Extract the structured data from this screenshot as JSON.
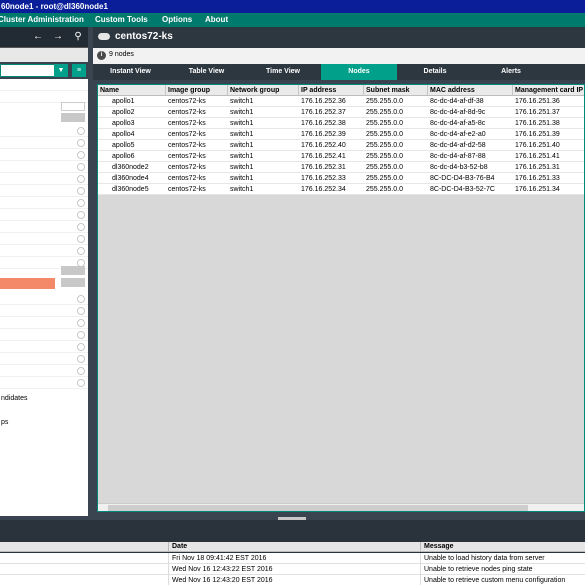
{
  "window": {
    "title": "60node1 - root@dl360node1"
  },
  "menu": [
    {
      "label": "Cluster Administration"
    },
    {
      "label": "Custom Tools"
    },
    {
      "label": "Options"
    },
    {
      "label": "About"
    }
  ],
  "left_panel": {
    "candidates_label": "ndidates",
    "groups_label": "ps"
  },
  "header": {
    "title": "centos72-ks",
    "node_count": "9 nodes"
  },
  "tabs": [
    {
      "label": "Instant View",
      "active": false
    },
    {
      "label": "Table View",
      "active": false
    },
    {
      "label": "Time View",
      "active": false
    },
    {
      "label": "Nodes",
      "active": true
    },
    {
      "label": "Details",
      "active": false
    },
    {
      "label": "Alerts",
      "active": false
    }
  ],
  "table": {
    "columns": [
      "Name",
      "Image group",
      "Network group",
      "IP address",
      "Subnet mask",
      "MAC address",
      "Management card IP"
    ],
    "rows": [
      [
        "apollo1",
        "centos72-ks",
        "switch1",
        "176.16.252.36",
        "255.255.0.0",
        "8c-dc-d4-af-df-38",
        "176.16.251.36"
      ],
      [
        "apollo2",
        "centos72-ks",
        "switch1",
        "176.16.252.37",
        "255.255.0.0",
        "8c-dc-d4-af-8d-9c",
        "176.16.251.37"
      ],
      [
        "apollo3",
        "centos72-ks",
        "switch1",
        "176.16.252.38",
        "255.255.0.0",
        "8c-dc-d4-af-a5-8c",
        "176.16.251.38"
      ],
      [
        "apollo4",
        "centos72-ks",
        "switch1",
        "176.16.252.39",
        "255.255.0.0",
        "8c-dc-d4-af-e2-a0",
        "176.16.251.39"
      ],
      [
        "apollo5",
        "centos72-ks",
        "switch1",
        "176.16.252.40",
        "255.255.0.0",
        "8c-dc-d4-af-d2-58",
        "176.16.251.40"
      ],
      [
        "apollo6",
        "centos72-ks",
        "switch1",
        "176.16.252.41",
        "255.255.0.0",
        "8c-dc-d4-af-87-88",
        "176.16.251.41"
      ],
      [
        "dl360node2",
        "centos72-ks",
        "switch1",
        "176.16.252.31",
        "255.255.0.0",
        "8c-dc-d4-b3-52-b8",
        "176.16.251.31"
      ],
      [
        "dl360node4",
        "centos72-ks",
        "switch1",
        "176.16.252.33",
        "255.255.0.0",
        "8C-DC-D4-B3-76-B4",
        "176.16.251.33"
      ],
      [
        "dl360node5",
        "centos72-ks",
        "switch1",
        "176.16.252.34",
        "255.255.0.0",
        "8C-DC-D4-B3-52-7C",
        "176.16.251.34"
      ]
    ]
  },
  "log": {
    "columns": [
      "Date",
      "Message"
    ],
    "rows": [
      [
        "Fri Nov 18 09:41:42 EST 2016",
        "Unable to load history data from server"
      ],
      [
        "Wed Nov 16 12:43:22 EST 2016",
        "Unable to retrieve nodes ping state"
      ],
      [
        "Wed Nov 16 12:43:20 EST 2016",
        "Unable to retrieve custom menu configuration"
      ]
    ]
  },
  "colors": {
    "title_bar": "#0a1e9a",
    "menu_bar": "#007a6c",
    "accent": "#00a08a",
    "highlight": "#f4896a"
  }
}
